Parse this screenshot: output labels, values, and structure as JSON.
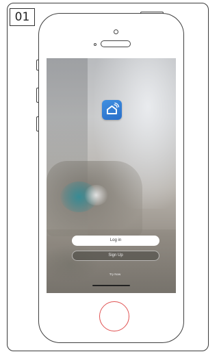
{
  "step_badge": "01",
  "app": {
    "logo_icon": "smart-home-icon",
    "accent_color": "#3a86d8"
  },
  "buttons": {
    "login_label": "Log in",
    "signup_label": "Sign Up"
  },
  "try_label": "Try Now"
}
